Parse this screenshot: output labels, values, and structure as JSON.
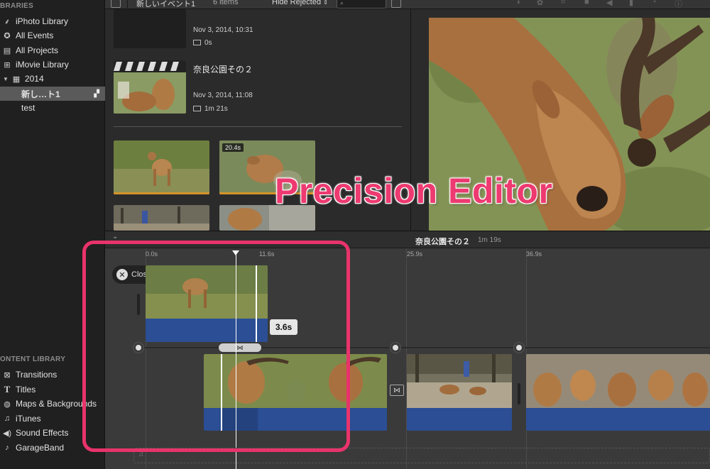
{
  "sidebar": {
    "libraries_header": "BRARIES",
    "items": [
      {
        "label": "iPhoto Library",
        "icon": "palm-tree-icon"
      },
      {
        "label": "All Events",
        "icon": "star-icon"
      },
      {
        "label": "All Projects",
        "icon": "clapboard-icon"
      },
      {
        "label": "iMovie Library",
        "icon": "grid-icon"
      }
    ],
    "year": "2014",
    "events": [
      {
        "label": "新し…ト1",
        "selected": true
      },
      {
        "label": "test",
        "selected": false
      }
    ],
    "content_header": "ONTENT LIBRARY",
    "content_items": [
      {
        "label": "Transitions",
        "icon": "transition-icon"
      },
      {
        "label": "Titles",
        "icon": "t-icon"
      },
      {
        "label": "Maps & Backgrounds",
        "icon": "globe-icon"
      },
      {
        "label": "iTunes",
        "icon": "music-note-icon"
      },
      {
        "label": "Sound Effects",
        "icon": "speaker-icon"
      },
      {
        "label": "GarageBand",
        "icon": "guitar-icon"
      }
    ]
  },
  "toolbar": {
    "event_name": "新しいイベント1",
    "item_count": "6 items",
    "filter": "Hide Rejected"
  },
  "browser": {
    "event1": {
      "date": "Nov 3, 2014, 10:31",
      "duration": "0s"
    },
    "event2": {
      "title": "奈良公園その２",
      "date": "Nov 3, 2014, 11:08",
      "duration": "1m 21s"
    },
    "clip_badge": "20.4s"
  },
  "overlay": {
    "text": "Precision Editor"
  },
  "timeline": {
    "title": "奈良公園その２",
    "duration": "1m 19s",
    "ruler": [
      "0.0s",
      "11.6s",
      "25.9s",
      "36.9s"
    ],
    "close_button": "Close Precision Editor",
    "transition_duration": "3.6s"
  },
  "colors": {
    "accent": "#e8336b",
    "audio": "#2b4e94",
    "selection": "#5a5a5a"
  }
}
